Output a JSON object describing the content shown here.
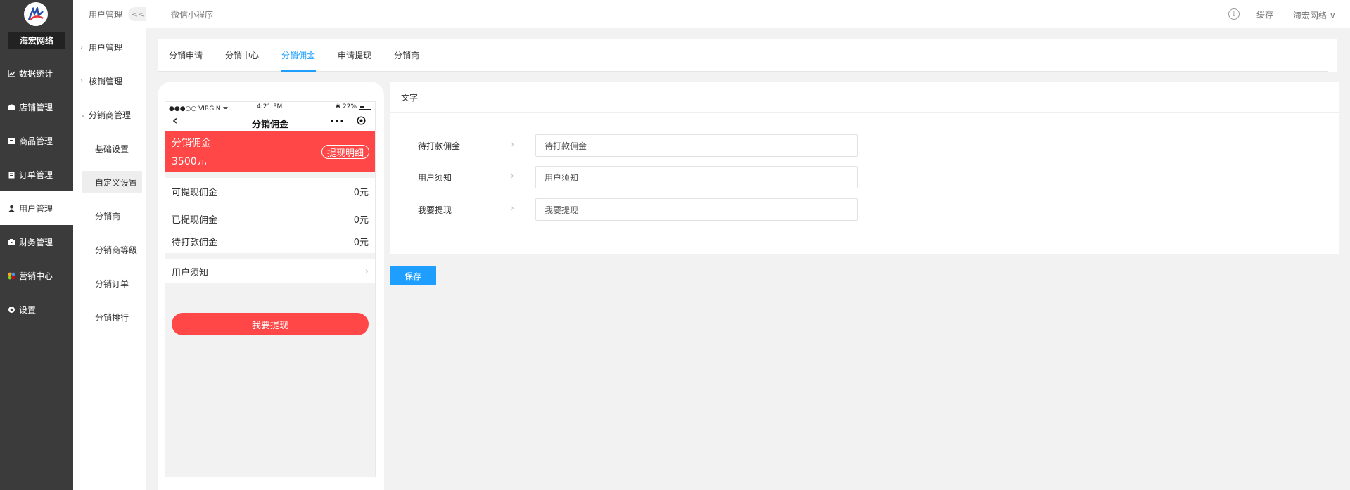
{
  "brand": {
    "name": "海宏网络"
  },
  "nav": {
    "items": [
      {
        "label": "数据统计",
        "icon": "chart-line-icon"
      },
      {
        "label": "店铺管理",
        "icon": "store-icon"
      },
      {
        "label": "商品管理",
        "icon": "goods-icon"
      },
      {
        "label": "订单管理",
        "icon": "order-icon"
      },
      {
        "label": "用户管理",
        "icon": "user-icon"
      },
      {
        "label": "财务管理",
        "icon": "finance-icon"
      },
      {
        "label": "营销中心",
        "icon": "marketing-icon"
      },
      {
        "label": "设置",
        "icon": "settings-icon"
      }
    ]
  },
  "subnav": {
    "title": "用户管理",
    "collapse": "<<",
    "groups": [
      {
        "label": "用户管理"
      },
      {
        "label": "核销管理"
      },
      {
        "label": "分销商管理"
      }
    ],
    "items": [
      {
        "label": "基础设置"
      },
      {
        "label": "自定义设置"
      },
      {
        "label": "分销商"
      },
      {
        "label": "分销商等级"
      },
      {
        "label": "分销订单"
      },
      {
        "label": "分销排行"
      }
    ]
  },
  "topbar": {
    "breadcrumb": "微信小程序",
    "cache": "缓存",
    "user": "海宏网络 ∨"
  },
  "tabs": [
    {
      "label": "分销申请"
    },
    {
      "label": "分销中心"
    },
    {
      "label": "分销佣金"
    },
    {
      "label": "申请提现"
    },
    {
      "label": "分销商"
    }
  ],
  "phone": {
    "status_left": "●●●○○ VIRGIN ᯤ",
    "status_time": "4:21 PM",
    "status_right": "✱ 22%",
    "title": "分销佣金",
    "header_label": "分销佣金",
    "header_amount": "3500元",
    "detail_button": "提现明细",
    "rows": [
      {
        "label": "可提现佣金",
        "value": "0元"
      },
      {
        "label": "已提现佣金",
        "value": "0元"
      },
      {
        "label": "待打款佣金",
        "value": "0元"
      }
    ],
    "notice": "用户须知",
    "withdraw_button": "我要提现"
  },
  "form": {
    "section_title": "文字",
    "fields": [
      {
        "label": "待打款佣金",
        "value": "待打款佣金"
      },
      {
        "label": "用户须知",
        "value": "用户须知"
      },
      {
        "label": "我要提现",
        "value": "我要提现"
      }
    ],
    "save_label": "保存"
  },
  "colors": {
    "accent": "#1e9fff",
    "brand_red": "#ff4747",
    "sidebar": "#3b3b3b"
  }
}
